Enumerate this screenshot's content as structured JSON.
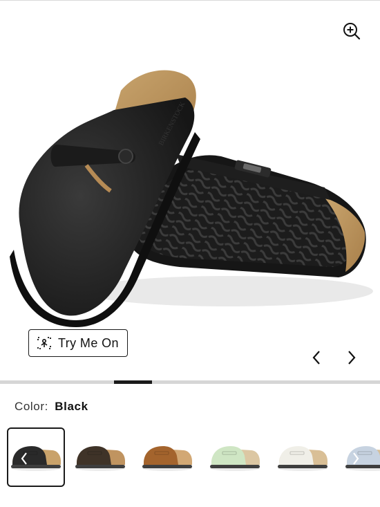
{
  "gallery": {
    "try_on_label": "Try Me On",
    "zoom_icon": "zoom-in-icon",
    "try_on_icon": "ar-scan-icon",
    "prev_icon": "chevron-left-icon",
    "next_icon": "chevron-right-icon",
    "progress": 0.1
  },
  "color": {
    "label": "Color:",
    "value": "Black"
  },
  "swatches": [
    {
      "name": "Black",
      "color": "#2a2a2a",
      "footbed": "#c9a26a",
      "selected": true
    },
    {
      "name": "Dark brown",
      "color": "#3f3328",
      "footbed": "#c09460",
      "selected": false
    },
    {
      "name": "Mink",
      "color": "#a4642d",
      "footbed": "#d2a874",
      "selected": false
    },
    {
      "name": "Mint",
      "color": "#cfe6c4",
      "footbed": "#dcc7a3",
      "selected": false
    },
    {
      "name": "White",
      "color": "#f0efe8",
      "footbed": "#d9bf96",
      "selected": false
    },
    {
      "name": "Light blue",
      "color": "#c7d3e1",
      "footbed": "#d6bf9a",
      "selected": false
    }
  ]
}
